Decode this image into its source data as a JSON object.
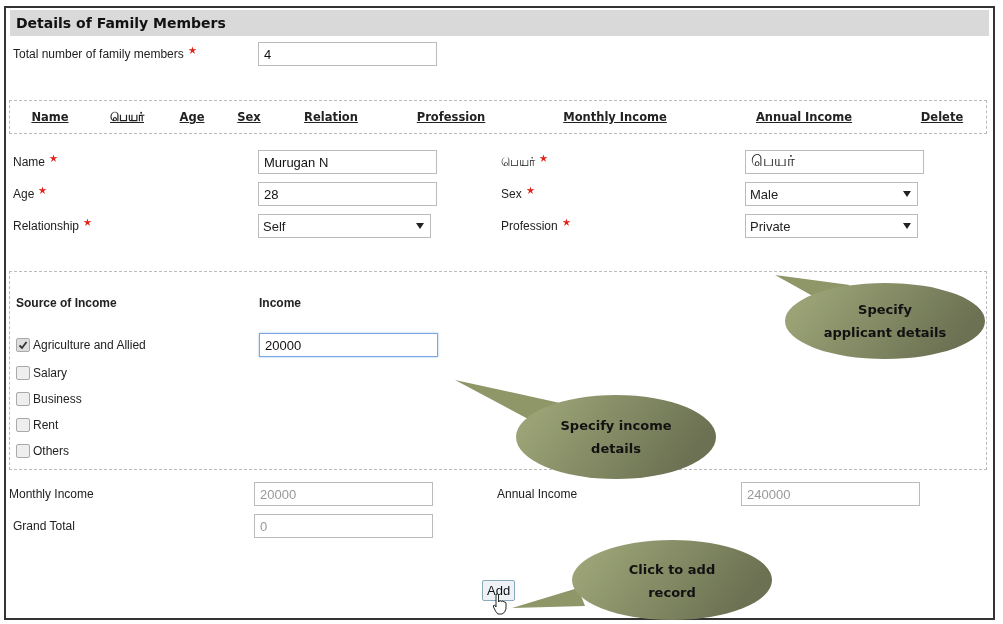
{
  "section_title": "Details of Family Members",
  "total_members": {
    "label": "Total number of family members",
    "required": true,
    "value": "4"
  },
  "table_columns": [
    "Name",
    "பெயர்",
    "Age",
    "Sex",
    "Relation",
    "Profession",
    "Monthly Income",
    "Annual Income",
    "Delete"
  ],
  "member_fields": [
    {
      "label": "Name",
      "required": true,
      "kind": "text",
      "value": "Murugan N"
    },
    {
      "label": "பெயர்",
      "required": true,
      "kind": "text",
      "value": "பெயர்"
    },
    {
      "label": "Age",
      "required": true,
      "kind": "text",
      "value": "28"
    },
    {
      "label": "Sex",
      "required": true,
      "kind": "select",
      "value": "Male"
    },
    {
      "label": "Relationship",
      "required": true,
      "kind": "select",
      "value": "Self"
    },
    {
      "label": "Profession",
      "required": true,
      "kind": "select",
      "value": "Private"
    }
  ],
  "income_section": {
    "source_heading": "Source of Income",
    "income_heading": "Income",
    "sources": [
      {
        "label": "Agriculture and Allied",
        "checked": true,
        "income": "20000",
        "focused": true
      },
      {
        "label": "Salary",
        "checked": false
      },
      {
        "label": "Business",
        "checked": false
      },
      {
        "label": "Rent",
        "checked": false
      },
      {
        "label": "Others",
        "checked": false
      }
    ]
  },
  "totals": [
    {
      "label": "Monthly Income",
      "value": "20000",
      "disabled": true
    },
    {
      "label": "Annual Income",
      "value": "240000",
      "disabled": true
    },
    {
      "label": "Grand Total",
      "value": "0",
      "disabled": true
    }
  ],
  "add_button": "Add",
  "callouts": [
    {
      "lines": [
        "Specify",
        "applicant details"
      ]
    },
    {
      "lines": [
        "Specify income",
        "details"
      ]
    },
    {
      "lines": [
        "Click to add",
        "record"
      ]
    }
  ]
}
